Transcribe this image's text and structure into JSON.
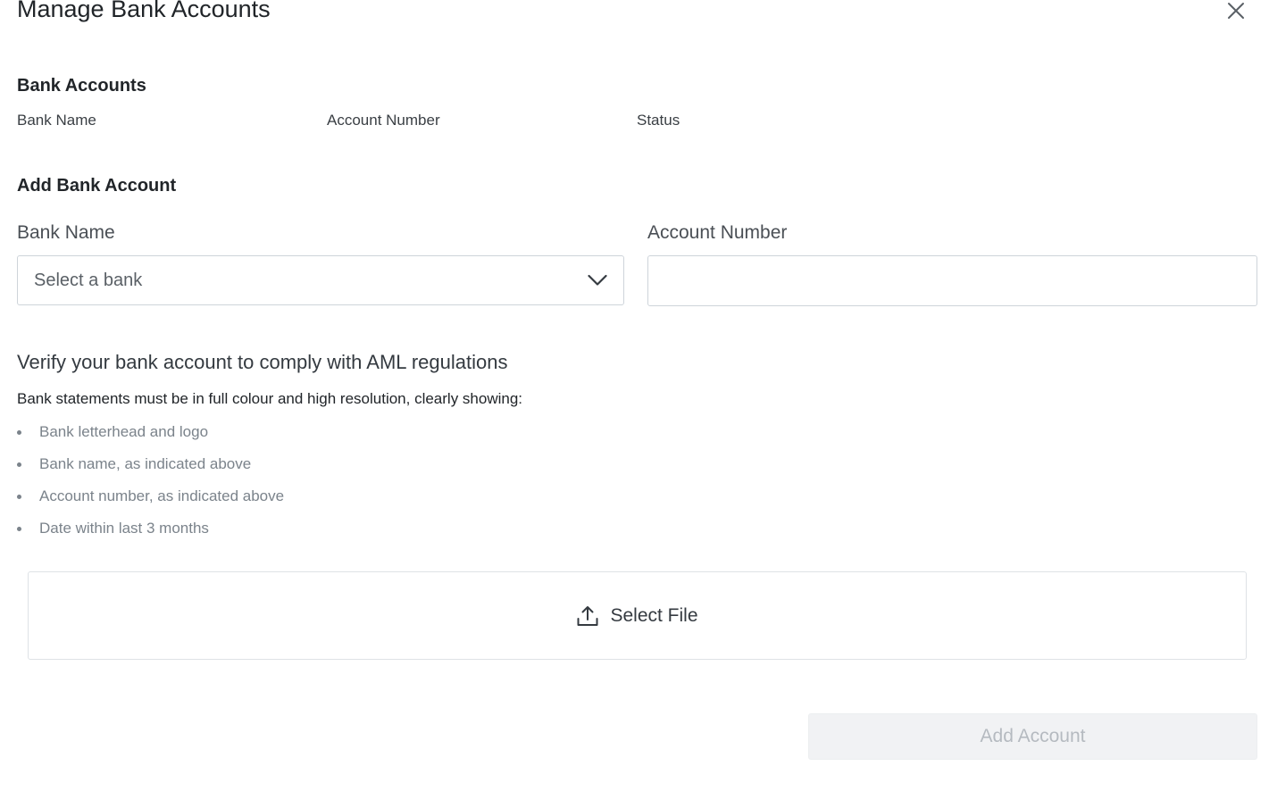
{
  "modal": {
    "title": "Manage Bank Accounts"
  },
  "accounts_section": {
    "heading": "Bank Accounts",
    "columns": [
      "Bank Name",
      "Account Number",
      "Status"
    ]
  },
  "add_section": {
    "heading": "Add Bank Account",
    "bank_name_label": "Bank Name",
    "bank_select_placeholder": "Select a bank",
    "account_number_label": "Account Number",
    "account_number_value": ""
  },
  "verification": {
    "title": "Verify your bank account to comply with AML regulations",
    "description": "Bank statements must be in full colour and high resolution, clearly showing:",
    "requirements": [
      "Bank letterhead and logo",
      "Bank name, as indicated above",
      "Account number, as indicated above",
      "Date within last 3 months"
    ]
  },
  "upload": {
    "label": "Select File",
    "icon": "upload-icon"
  },
  "actions": {
    "add_account_label": "Add Account",
    "add_account_disabled": true
  },
  "icons": {
    "close": "close-icon",
    "dropdown": "chevron-down-icon"
  },
  "colors": {
    "text": "#212529",
    "muted": "#7b838b",
    "border": "#ced4da",
    "disabled_bg": "#f1f2f4",
    "disabled_text": "#b5bac0"
  }
}
